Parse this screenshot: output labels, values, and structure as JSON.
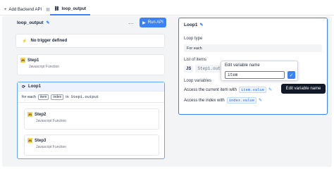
{
  "tabs": {
    "add_label": "Add Backend API",
    "active_label": "loop_output"
  },
  "flow": {
    "title": "loop_output",
    "run_label": "Run API",
    "trigger_label": "No trigger defined"
  },
  "steps": [
    {
      "name": "Step1",
      "type": "Javascript Function"
    },
    {
      "name": "Step2",
      "type": "Javascript Function"
    },
    {
      "name": "Step3",
      "type": "Javascript Function"
    }
  ],
  "loop": {
    "name": "Loop1",
    "for_each_label": "for each",
    "item_chip": "item",
    "index_chip": "index",
    "in_label": "in",
    "source": "Step1.output"
  },
  "panel": {
    "title": "Loop1",
    "loop_type_label": "Loop type",
    "loop_type_value": "For each",
    "list_items_label": "List of items",
    "js_badge": "JS",
    "list_items_value": "Step1.outpu",
    "loop_vars_label": "Loop variables",
    "current_item_label": "Access the current item with",
    "current_item_var": "item.value",
    "index_label": "Access the index with",
    "index_var": "index.value"
  },
  "popover": {
    "label": "Edit variable name",
    "input_value": "item"
  },
  "tooltip": {
    "label": "Edit variable name"
  },
  "colors": {
    "accent": "#3b82f6",
    "js_badge": "#fcd34d",
    "tooltip_bg": "#111827"
  }
}
